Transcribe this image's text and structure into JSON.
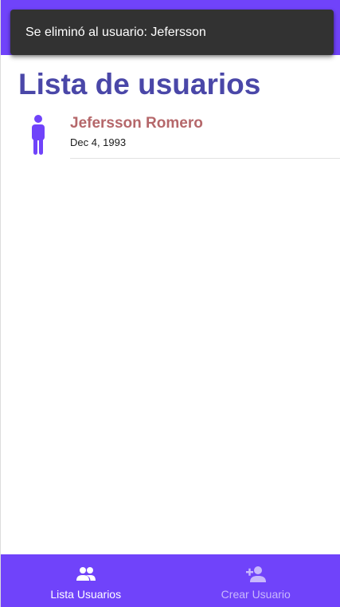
{
  "snackbar": {
    "message": "Se eliminó al usuario: Jefersson"
  },
  "page": {
    "title": "Lista de usuarios"
  },
  "users": [
    {
      "name": "Jefersson Romero",
      "date": "Dec 4, 1993",
      "icon": "person-icon"
    }
  ],
  "bottom_nav": {
    "items": [
      {
        "label": "Lista Usuarios",
        "icon": "people-icon",
        "active": true
      },
      {
        "label": "Crear Usuario",
        "icon": "person-add-icon",
        "active": false
      }
    ]
  },
  "colors": {
    "primary": "#7043fa",
    "title": "#4a47a8",
    "user_name": "#b5676a",
    "snackbar_bg": "#323232",
    "nav_inactive": "#c9b8fc"
  }
}
